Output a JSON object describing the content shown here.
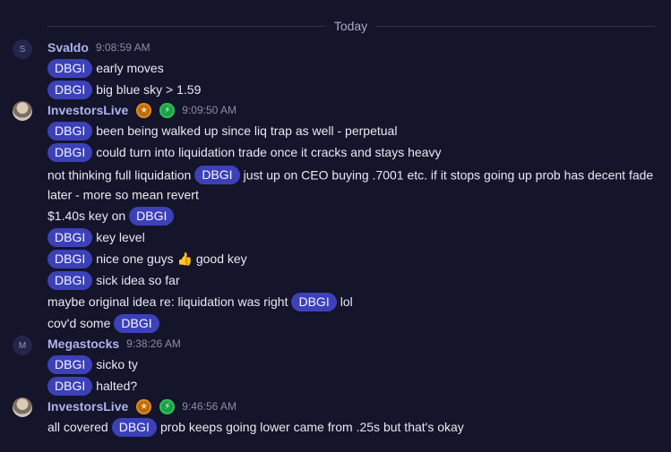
{
  "divider": {
    "label": "Today"
  },
  "tag": "DBGI",
  "groups": [
    {
      "user": "Svaldo",
      "avatar_letter": "S",
      "time": "9:08:59 AM",
      "messages": [
        {
          "pre": "",
          "post": "early moves"
        },
        {
          "pre": "",
          "post": "big blue sky > 1.59"
        }
      ]
    },
    {
      "user": "InvestorsLive",
      "avatar_letter": "",
      "time": "9:09:50 AM",
      "messages": [
        {
          "pre": "",
          "post": "been being walked up since liq trap as well - perpetual"
        },
        {
          "pre": "",
          "post": "could turn into liquidation trade once it cracks and stays heavy"
        },
        {
          "pre": "not thinking full liquidation",
          "post": "just up on CEO buying .7001 etc. if it stops going up prob has decent fade later - more so mean revert"
        },
        {
          "pre": "$1.40s key on",
          "post": ""
        },
        {
          "pre": "",
          "post": "key level"
        },
        {
          "pre": "",
          "post": "nice one guys 👍 good key"
        },
        {
          "pre": "",
          "post": "sick idea so far"
        },
        {
          "pre": "maybe original idea re: liquidation was right",
          "post": "lol"
        },
        {
          "pre": "cov'd some",
          "post": ""
        }
      ]
    },
    {
      "user": "Megastocks",
      "avatar_letter": "M",
      "time": "9:38:26 AM",
      "messages": [
        {
          "pre": "",
          "post": "sicko ty"
        },
        {
          "pre": "",
          "post": "halted?"
        }
      ]
    },
    {
      "user": "InvestorsLive",
      "avatar_letter": "",
      "time": "9:46:56 AM",
      "messages": [
        {
          "pre": "all covered",
          "post": "prob keeps going lower came from .25s but that's okay"
        }
      ]
    }
  ],
  "colors": {
    "background": "#14142a",
    "tag": "#3c41b8",
    "username": "#aeb3ee"
  },
  "icons": {
    "star_badge": "star-badge-icon",
    "bolt_badge": "lightning-badge-icon"
  }
}
